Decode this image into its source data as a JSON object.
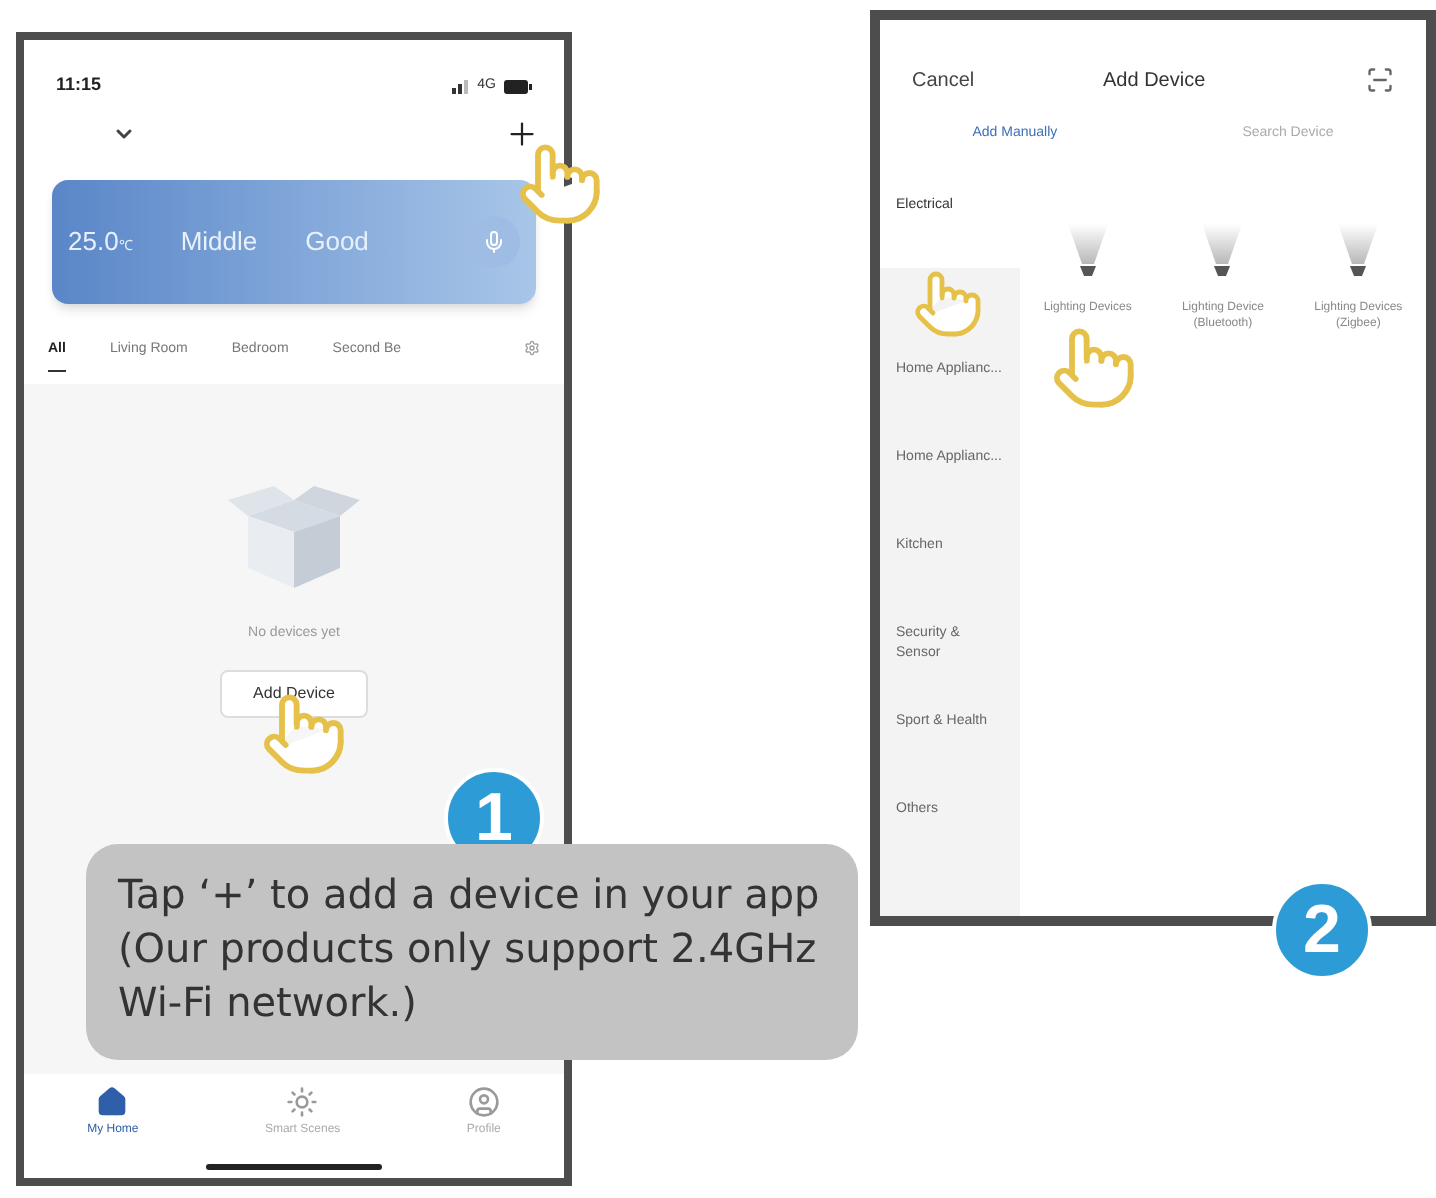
{
  "step1": {
    "badge": "1",
    "caption": "Tap ‘+’ to add a device in your app (Our products only support 2.4GHz Wi-Fi network.)",
    "phone": {
      "time": "11:15",
      "network": "4G",
      "weather": [
        {
          "value": "25.0",
          "unit": "℃"
        },
        {
          "value": "Middle"
        },
        {
          "value": "Good"
        }
      ],
      "tabs": [
        {
          "label": "All",
          "selected": true
        },
        {
          "label": "Living Room",
          "selected": false
        },
        {
          "label": "Bedroom",
          "selected": false
        },
        {
          "label": "Second Be",
          "selected": false
        }
      ],
      "empty_text": "No devices yet",
      "add_button": "Add Device",
      "nav": [
        {
          "label": "My Home",
          "kind": "home",
          "selected": true
        },
        {
          "label": "Smart Scenes",
          "kind": "scenes",
          "selected": false
        },
        {
          "label": "Profile",
          "kind": "profile",
          "selected": false
        }
      ]
    }
  },
  "step2": {
    "badge": "2",
    "phone": {
      "cancel": "Cancel",
      "title": "Add Device",
      "tabs": [
        {
          "label": "Add Manually",
          "selected": true
        },
        {
          "label": "Search Device",
          "selected": false
        }
      ],
      "categories": [
        {
          "label": "Electrical",
          "selected": true
        },
        {
          "label": "Home Applianc...",
          "selected": false
        },
        {
          "label": "Home Applianc...",
          "selected": false
        },
        {
          "label": "Kitchen",
          "selected": false
        },
        {
          "label": "Security & Sensor",
          "selected": false
        },
        {
          "label": "Sport & Health",
          "selected": false
        },
        {
          "label": "Others",
          "selected": false
        }
      ],
      "devices": [
        {
          "label": "Lighting Devices"
        },
        {
          "label": "Lighting Device (Bluetooth)"
        },
        {
          "label": "Lighting Devices (Zigbee)"
        }
      ]
    }
  }
}
